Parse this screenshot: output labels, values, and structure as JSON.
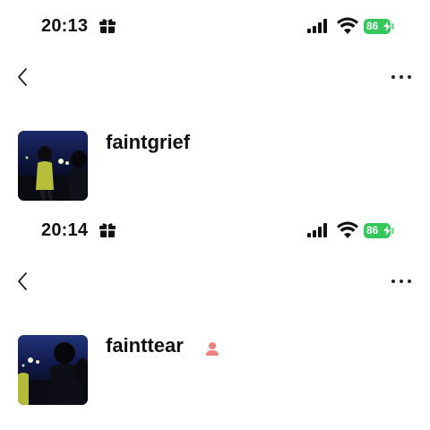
{
  "panels": [
    {
      "status_bar": {
        "time": "20:13",
        "battery": "86"
      },
      "profile": {
        "username": "faintgrief"
      }
    },
    {
      "status_bar": {
        "time": "20:14",
        "battery": "86"
      },
      "profile": {
        "username": "fainttear"
      }
    }
  ],
  "icons": {
    "time_icon": "gift-icon",
    "signal": "cellular-signal-icon",
    "wifi": "wifi-icon",
    "battery": "battery-charging-icon",
    "back": "chevron-left-icon",
    "more": "more-horizontal-icon",
    "badge": "person-icon"
  },
  "colors": {
    "battery": "#34c759",
    "badge": "#f08080"
  }
}
